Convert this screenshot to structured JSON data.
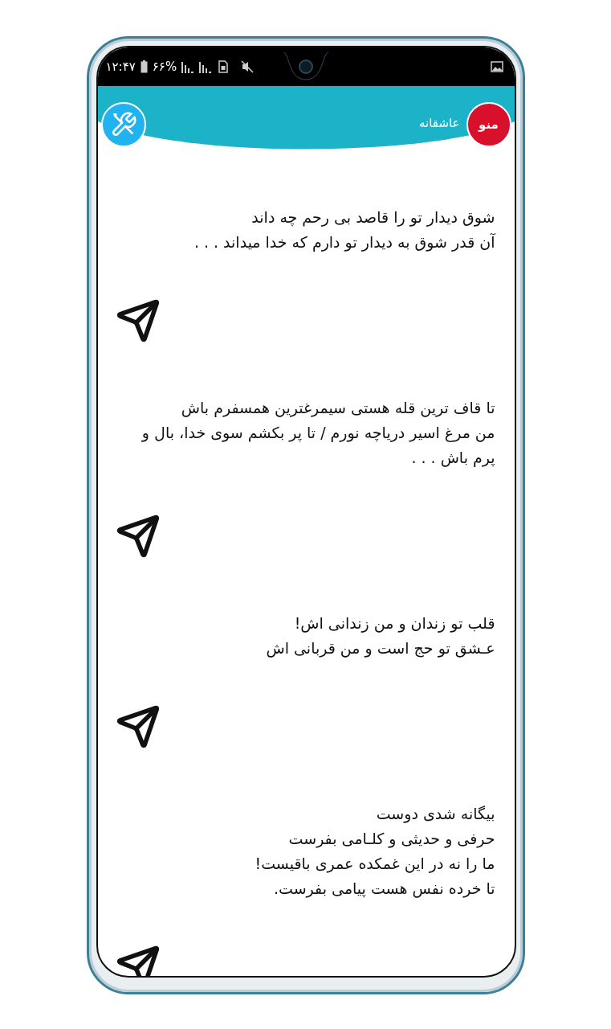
{
  "status_bar": {
    "time": "۱۲:۴۷",
    "battery": "۶۶%"
  },
  "header": {
    "menu_button": "منو",
    "title": "عاشقانه"
  },
  "poems": [
    {
      "lines": [
        "شوق دیدار تو را قاصد بی رحم چه داند",
        "آن قدر شوق به دیدار تو دارم که خدا میداند . . ."
      ]
    },
    {
      "lines": [
        "تا قاف ترین قله هستی سیمرغترین همسفرم باش",
        "من مرغ اسیر دریاچه نورم / تا پر بکشم سوی خدا، بال و پرم باش . . ."
      ]
    },
    {
      "lines": [
        "قلب تو زندان و من زندانی اش!",
        "عـشق تو حج است و من قربانی اش"
      ]
    },
    {
      "lines": [
        "بیگانه شدی دوست",
        "حرفی و حدیثی و کلـامی بفرست",
        "ما را نه در این غمکده عمری باقیست!",
        "تا خرده نفس هست پیامی بفرست."
      ]
    }
  ]
}
